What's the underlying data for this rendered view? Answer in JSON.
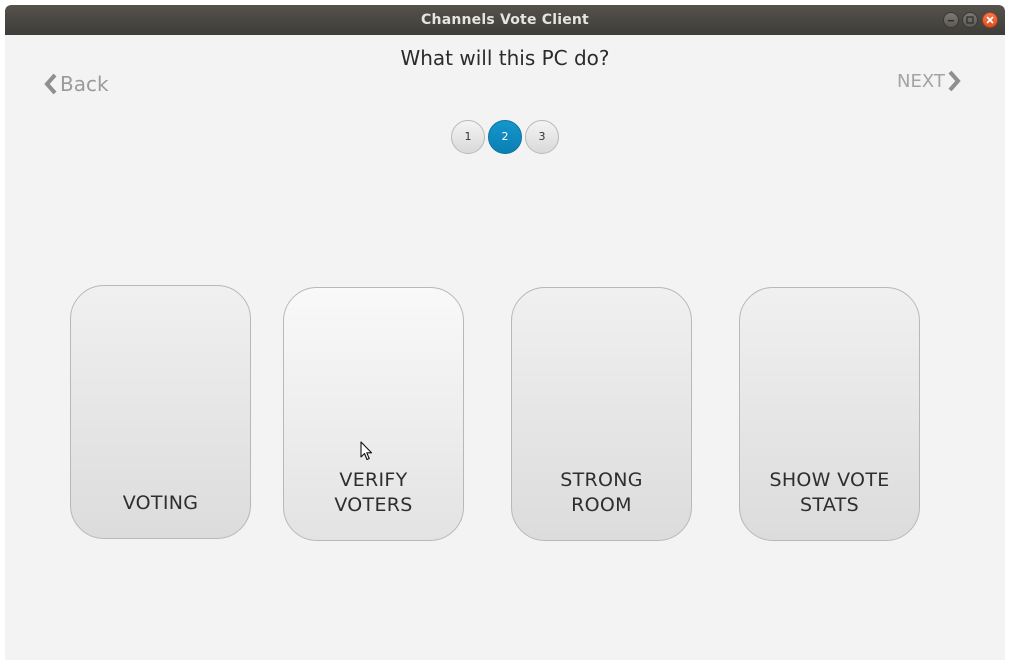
{
  "window": {
    "title": "Channels Vote Client"
  },
  "page": {
    "heading": "What will this PC do?"
  },
  "nav": {
    "back_label": "Back",
    "next_label": "NEXT"
  },
  "steps": {
    "items": [
      "1",
      "2",
      "3"
    ],
    "active": "2"
  },
  "options": [
    {
      "label": "VOTING"
    },
    {
      "label": "VERIFY\nVOTERS"
    },
    {
      "label": "STRONG\nROOM"
    },
    {
      "label": "SHOW VOTE\nSTATS"
    }
  ],
  "colors": {
    "titlebar": "#45423e",
    "background": "#f3f3f3",
    "active_step": "#0e88bf",
    "close_button": "#e5562b"
  },
  "icons": {
    "back": "chevron-left-icon",
    "next": "chevron-right-icon",
    "pointer": "mouse-pointer-icon"
  }
}
